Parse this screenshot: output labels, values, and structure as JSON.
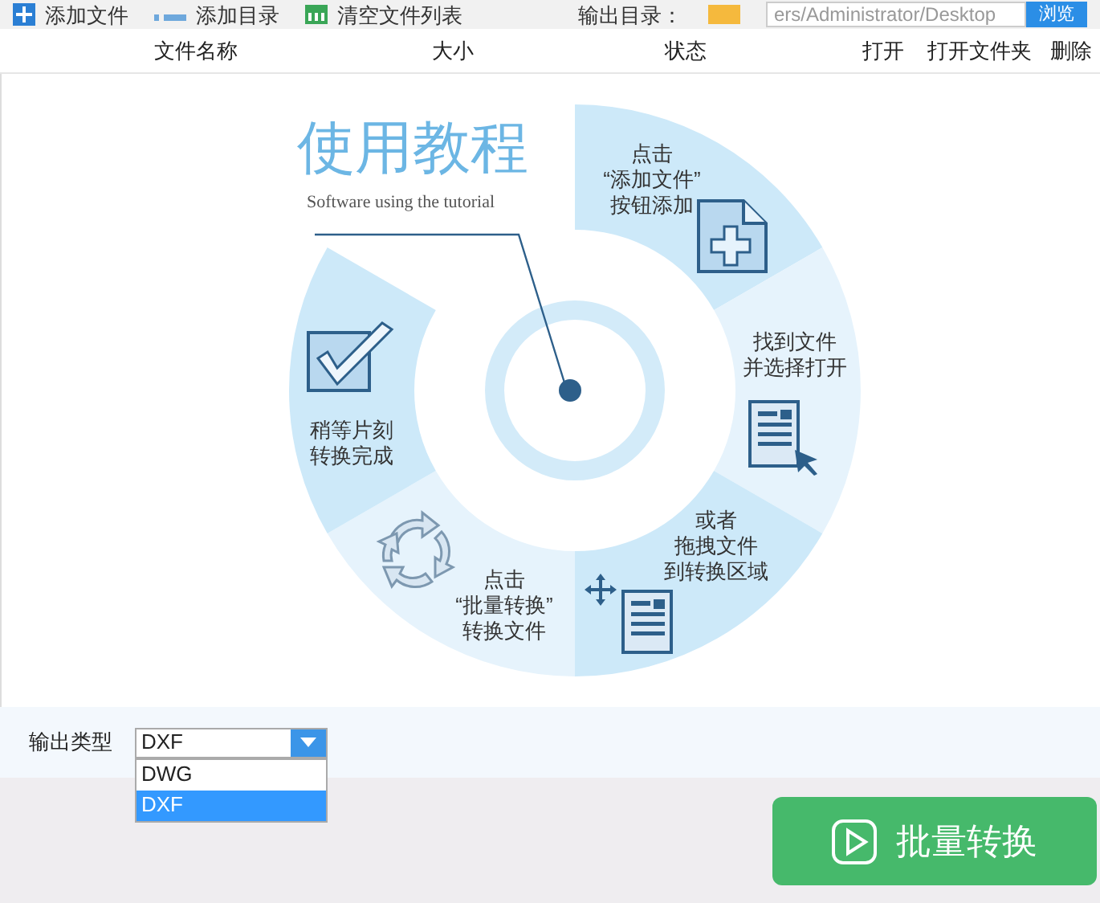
{
  "toolbar": {
    "buttons": [
      {
        "kind": "add-file",
        "label": "添加文件"
      },
      {
        "kind": "add-folder",
        "label": "添加目录"
      },
      {
        "kind": "clear",
        "label": "清空文件列表"
      }
    ],
    "output_dir_label": "输出目录：",
    "output_dir_value": "ers/Administrator/Desktop",
    "browse_button": "浏览"
  },
  "columns": [
    "文件名称",
    "大小",
    "状态",
    "打开",
    "打开文件夹",
    "删除"
  ],
  "tutorial": {
    "title": "使用教程",
    "subtitle": "Software using the tutorial",
    "steps": [
      {
        "kind": "add",
        "lines": [
          "点击",
          "“添加文件”",
          "按钮添加"
        ]
      },
      {
        "kind": "open",
        "lines": [
          "找到文件",
          "并选择打开"
        ]
      },
      {
        "kind": "drag",
        "lines": [
          "或者",
          "拖拽文件",
          "到转换区域"
        ]
      },
      {
        "kind": "convert",
        "lines": [
          "点击",
          "“批量转换”",
          "转换文件"
        ]
      },
      {
        "kind": "done",
        "lines": [
          "稍等片刻",
          "转换完成"
        ]
      }
    ]
  },
  "output_type": {
    "label": "输出类型",
    "value": "DXF",
    "options": [
      {
        "label": "DWG",
        "selected": false
      },
      {
        "label": "DXF",
        "selected": true
      }
    ]
  },
  "convert_button": "批量转换"
}
